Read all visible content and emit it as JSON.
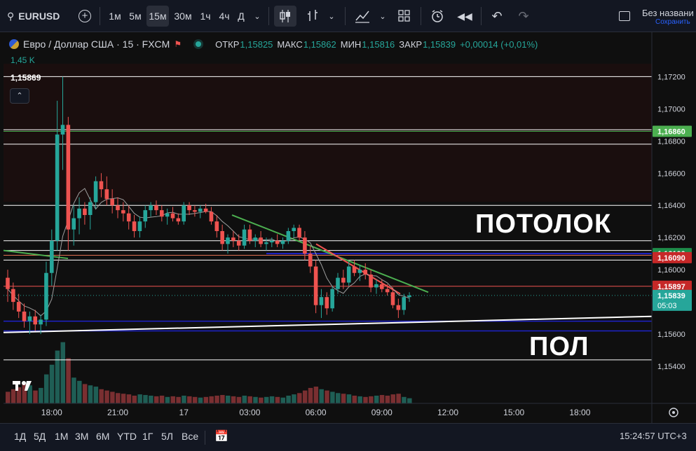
{
  "toolbar": {
    "symbol": "EURUSD",
    "intervals": [
      "1м",
      "5м",
      "15м",
      "30м",
      "1ч",
      "4ч",
      "Д"
    ],
    "active_interval": "15м",
    "layout_title": "Без названи",
    "layout_status": "Сохранить"
  },
  "legend": {
    "title": "Евро / Доллар США · 15 · FXCM",
    "o_label": "ОТКР",
    "o": "1,15825",
    "h_label": "МАКС",
    "h": "1,15862",
    "l_label": "МИН",
    "l": "1,15816",
    "c_label": "ЗАКР",
    "c": "1,15839",
    "change": "+0,00014 (+0,01%)",
    "volume": "1,45 K",
    "cursor_price": "1,15869"
  },
  "annotations": {
    "ceiling": "ПОТОЛОК",
    "floor": "ПОЛ"
  },
  "price_tags": {
    "tag1": "1,16860",
    "tag2": "1,16100",
    "tag3": "1,16090",
    "tag4": "1,15897",
    "last_price": "1,15839",
    "countdown": "05:03"
  },
  "colors": {
    "up": "#26a69a",
    "down": "#ef5350",
    "hline_green": "#4caf50",
    "hline_blue": "#1e22c9"
  },
  "chart_data": {
    "type": "candlestick",
    "symbol": "EURUSD",
    "interval": "15м",
    "ylim": [
      1.153,
      1.1728
    ],
    "y_ticks": [
      "1,17200",
      "1,17000",
      "1,16800",
      "1,16600",
      "1,16400",
      "1,16200",
      "1,16000",
      "1,15600",
      "1,15400"
    ],
    "y_tick_values": [
      1.172,
      1.17,
      1.168,
      1.166,
      1.164,
      1.162,
      1.16,
      1.156,
      1.154
    ],
    "x_ticks": [
      "18:00",
      "21:00",
      "17",
      "03:00",
      "06:00",
      "09:00",
      "12:00",
      "15:00",
      "18:00"
    ],
    "x_tick_bars": [
      8,
      20,
      32,
      44,
      56,
      68,
      80,
      92,
      104
    ],
    "candles": [
      {
        "o": 1.1595,
        "h": 1.16,
        "l": 1.158,
        "c": 1.1588
      },
      {
        "o": 1.1588,
        "h": 1.1592,
        "l": 1.1575,
        "c": 1.158
      },
      {
        "o": 1.158,
        "h": 1.1585,
        "l": 1.157,
        "c": 1.1574
      },
      {
        "o": 1.1574,
        "h": 1.1579,
        "l": 1.1564,
        "c": 1.1568
      },
      {
        "o": 1.1568,
        "h": 1.1574,
        "l": 1.156,
        "c": 1.1571
      },
      {
        "o": 1.1571,
        "h": 1.1575,
        "l": 1.1562,
        "c": 1.1566
      },
      {
        "o": 1.1566,
        "h": 1.1572,
        "l": 1.156,
        "c": 1.1569
      },
      {
        "o": 1.1569,
        "h": 1.1605,
        "l": 1.1565,
        "c": 1.1598
      },
      {
        "o": 1.1598,
        "h": 1.1625,
        "l": 1.159,
        "c": 1.1618
      },
      {
        "o": 1.1618,
        "h": 1.1705,
        "l": 1.1612,
        "c": 1.1684
      },
      {
        "o": 1.1684,
        "h": 1.172,
        "l": 1.1662,
        "c": 1.169
      },
      {
        "o": 1.169,
        "h": 1.1695,
        "l": 1.1612,
        "c": 1.1625
      },
      {
        "o": 1.1625,
        "h": 1.164,
        "l": 1.1615,
        "c": 1.1632
      },
      {
        "o": 1.1632,
        "h": 1.1645,
        "l": 1.1622,
        "c": 1.1638
      },
      {
        "o": 1.1638,
        "h": 1.1642,
        "l": 1.1628,
        "c": 1.1634
      },
      {
        "o": 1.1634,
        "h": 1.1645,
        "l": 1.1625,
        "c": 1.1642
      },
      {
        "o": 1.1642,
        "h": 1.1658,
        "l": 1.1638,
        "c": 1.1655
      },
      {
        "o": 1.1655,
        "h": 1.166,
        "l": 1.1645,
        "c": 1.165
      },
      {
        "o": 1.165,
        "h": 1.1658,
        "l": 1.164,
        "c": 1.1644
      },
      {
        "o": 1.1644,
        "h": 1.165,
        "l": 1.1635,
        "c": 1.164
      },
      {
        "o": 1.164,
        "h": 1.1645,
        "l": 1.1632,
        "c": 1.1637
      },
      {
        "o": 1.1637,
        "h": 1.1642,
        "l": 1.163,
        "c": 1.1635
      },
      {
        "o": 1.1635,
        "h": 1.164,
        "l": 1.1625,
        "c": 1.163
      },
      {
        "o": 1.163,
        "h": 1.1634,
        "l": 1.162,
        "c": 1.1624
      },
      {
        "o": 1.1624,
        "h": 1.1633,
        "l": 1.162,
        "c": 1.163
      },
      {
        "o": 1.163,
        "h": 1.164,
        "l": 1.1626,
        "c": 1.1637
      },
      {
        "o": 1.1637,
        "h": 1.1642,
        "l": 1.1633,
        "c": 1.164
      },
      {
        "o": 1.164,
        "h": 1.1643,
        "l": 1.1634,
        "c": 1.1637
      },
      {
        "o": 1.1637,
        "h": 1.164,
        "l": 1.163,
        "c": 1.1633
      },
      {
        "o": 1.1633,
        "h": 1.1638,
        "l": 1.1628,
        "c": 1.1635
      },
      {
        "o": 1.1635,
        "h": 1.1639,
        "l": 1.163,
        "c": 1.1632
      },
      {
        "o": 1.1632,
        "h": 1.1635,
        "l": 1.1628,
        "c": 1.163
      },
      {
        "o": 1.163,
        "h": 1.1642,
        "l": 1.1628,
        "c": 1.164
      },
      {
        "o": 1.164,
        "h": 1.1642,
        "l": 1.1634,
        "c": 1.1637
      },
      {
        "o": 1.1637,
        "h": 1.164,
        "l": 1.1633,
        "c": 1.1636
      },
      {
        "o": 1.1636,
        "h": 1.164,
        "l": 1.1632,
        "c": 1.1638
      },
      {
        "o": 1.1638,
        "h": 1.1641,
        "l": 1.1635,
        "c": 1.1636
      },
      {
        "o": 1.1636,
        "h": 1.1639,
        "l": 1.1628,
        "c": 1.163
      },
      {
        "o": 1.163,
        "h": 1.1634,
        "l": 1.162,
        "c": 1.1624
      },
      {
        "o": 1.1624,
        "h": 1.1628,
        "l": 1.1612,
        "c": 1.1616
      },
      {
        "o": 1.1616,
        "h": 1.1622,
        "l": 1.161,
        "c": 1.162
      },
      {
        "o": 1.162,
        "h": 1.1624,
        "l": 1.1614,
        "c": 1.1618
      },
      {
        "o": 1.1618,
        "h": 1.1622,
        "l": 1.1612,
        "c": 1.1615
      },
      {
        "o": 1.1615,
        "h": 1.1628,
        "l": 1.1613,
        "c": 1.1625
      },
      {
        "o": 1.1625,
        "h": 1.1628,
        "l": 1.1616,
        "c": 1.1618
      },
      {
        "o": 1.1618,
        "h": 1.1622,
        "l": 1.1614,
        "c": 1.162
      },
      {
        "o": 1.162,
        "h": 1.1624,
        "l": 1.1614,
        "c": 1.1616
      },
      {
        "o": 1.1616,
        "h": 1.162,
        "l": 1.1612,
        "c": 1.1617
      },
      {
        "o": 1.1617,
        "h": 1.162,
        "l": 1.1614,
        "c": 1.1618
      },
      {
        "o": 1.1618,
        "h": 1.1622,
        "l": 1.1614,
        "c": 1.1616
      },
      {
        "o": 1.1616,
        "h": 1.162,
        "l": 1.1613,
        "c": 1.1618
      },
      {
        "o": 1.1618,
        "h": 1.1626,
        "l": 1.1616,
        "c": 1.1624
      },
      {
        "o": 1.1624,
        "h": 1.1628,
        "l": 1.162,
        "c": 1.1626
      },
      {
        "o": 1.1626,
        "h": 1.1628,
        "l": 1.1618,
        "c": 1.162
      },
      {
        "o": 1.162,
        "h": 1.1624,
        "l": 1.1606,
        "c": 1.161
      },
      {
        "o": 1.161,
        "h": 1.1615,
        "l": 1.1598,
        "c": 1.1602
      },
      {
        "o": 1.1602,
        "h": 1.1606,
        "l": 1.1573,
        "c": 1.1578
      },
      {
        "o": 1.1578,
        "h": 1.1588,
        "l": 1.157,
        "c": 1.1583
      },
      {
        "o": 1.1583,
        "h": 1.1586,
        "l": 1.1572,
        "c": 1.1576
      },
      {
        "o": 1.1576,
        "h": 1.159,
        "l": 1.1574,
        "c": 1.1588
      },
      {
        "o": 1.1588,
        "h": 1.1598,
        "l": 1.1585,
        "c": 1.1595
      },
      {
        "o": 1.1595,
        "h": 1.16,
        "l": 1.1588,
        "c": 1.1592
      },
      {
        "o": 1.1592,
        "h": 1.1605,
        "l": 1.159,
        "c": 1.1602
      },
      {
        "o": 1.1602,
        "h": 1.1606,
        "l": 1.1596,
        "c": 1.1598
      },
      {
        "o": 1.1598,
        "h": 1.1603,
        "l": 1.1593,
        "c": 1.16
      },
      {
        "o": 1.16,
        "h": 1.1604,
        "l": 1.1594,
        "c": 1.1597
      },
      {
        "o": 1.1597,
        "h": 1.16,
        "l": 1.1586,
        "c": 1.1589
      },
      {
        "o": 1.1589,
        "h": 1.1594,
        "l": 1.1585,
        "c": 1.1591
      },
      {
        "o": 1.1591,
        "h": 1.1594,
        "l": 1.1586,
        "c": 1.1588
      },
      {
        "o": 1.1588,
        "h": 1.1591,
        "l": 1.1584,
        "c": 1.1586
      },
      {
        "o": 1.1586,
        "h": 1.1589,
        "l": 1.1576,
        "c": 1.1578
      },
      {
        "o": 1.1578,
        "h": 1.1582,
        "l": 1.157,
        "c": 1.1575
      },
      {
        "o": 1.1575,
        "h": 1.1585,
        "l": 1.1572,
        "c": 1.1583
      },
      {
        "o": 1.1583,
        "h": 1.1586,
        "l": 1.158,
        "c": 1.1584
      }
    ],
    "volumes": [
      18,
      22,
      25,
      30,
      28,
      20,
      24,
      45,
      60,
      82,
      95,
      70,
      40,
      35,
      30,
      28,
      26,
      22,
      20,
      18,
      16,
      15,
      14,
      12,
      14,
      13,
      12,
      11,
      12,
      10,
      11,
      10,
      12,
      11,
      10,
      9,
      10,
      11,
      12,
      13,
      12,
      11,
      10,
      12,
      11,
      10,
      9,
      10,
      11,
      10,
      9,
      12,
      14,
      16,
      20,
      24,
      26,
      22,
      20,
      18,
      16,
      15,
      14,
      12,
      11,
      10,
      11,
      12,
      13,
      12,
      14,
      15,
      10,
      8
    ]
  }
}
